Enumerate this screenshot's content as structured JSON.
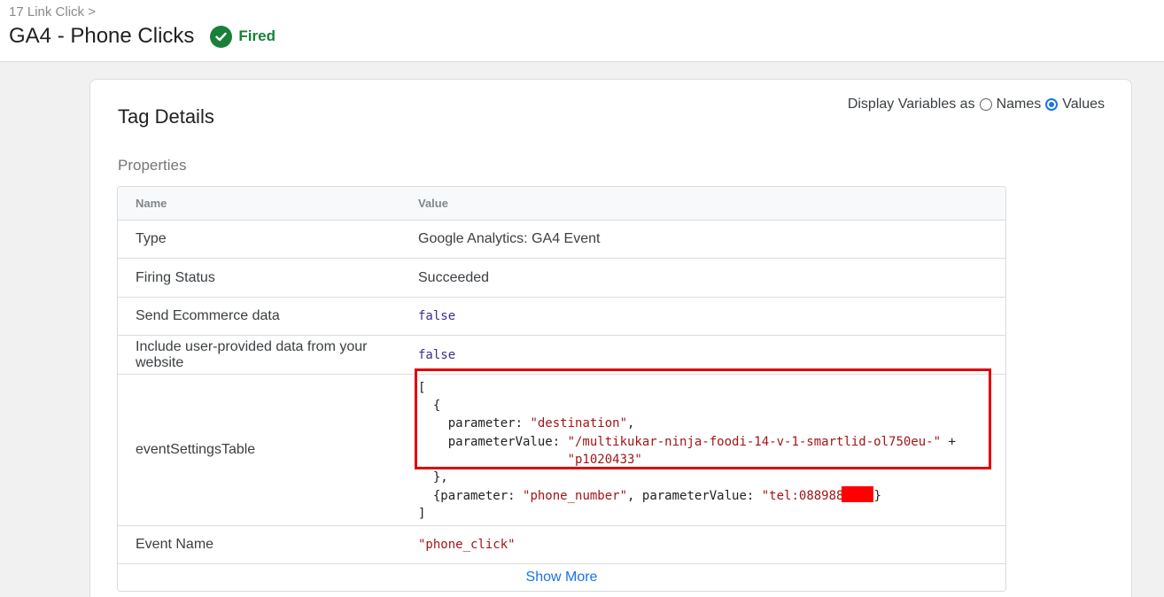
{
  "header": {
    "breadcrumb": "17 Link Click >",
    "title": "GA4 - Phone Clicks",
    "status": "Fired",
    "status_color": "#188038",
    "status_icon": "check-circle-icon"
  },
  "card": {
    "title": "Tag Details",
    "display_vars_label": "Display Variables as",
    "options": [
      "Names",
      "Values"
    ],
    "selected": "Values",
    "section_label": "Properties"
  },
  "table": {
    "headers": [
      "Name",
      "Value"
    ],
    "rows": [
      {
        "name": "Type",
        "value": "Google Analytics: GA4 Event"
      },
      {
        "name": "Firing Status",
        "value": "Succeeded"
      },
      {
        "name": "Send Ecommerce data",
        "value": "false"
      },
      {
        "name": "Include user-provided data from your website",
        "value": "false"
      },
      {
        "name": "eventSettingsTable",
        "value": {
          "open_bracket": "[",
          "open_brace": "  {",
          "param_key": "    parameter: ",
          "param_val": "\"destination\"",
          "param_comma": ",",
          "pv_key": "    parameterValue: ",
          "pv_val1": "\"/multikukar-ninja-foodi-14-v-1-smartlid-ol750eu-\"",
          "pv_plus": " +",
          "pv_indent": "                    ",
          "pv_val2": "\"p1020433\"",
          "close_brace": "  },",
          "line2_open": "  {parameter: ",
          "line2_param": "\"phone_number\"",
          "line2_mid": ", parameterValue: ",
          "line2_val": "\"tel:088988",
          "line2_close": "}",
          "close_bracket": "]"
        }
      },
      {
        "name": "Event Name",
        "value": "\"phone_click\""
      }
    ],
    "show_more": "Show More"
  },
  "colors": {
    "accent": "#1a73e8",
    "highlight": "#e00000",
    "redaction": "#ff0000"
  }
}
